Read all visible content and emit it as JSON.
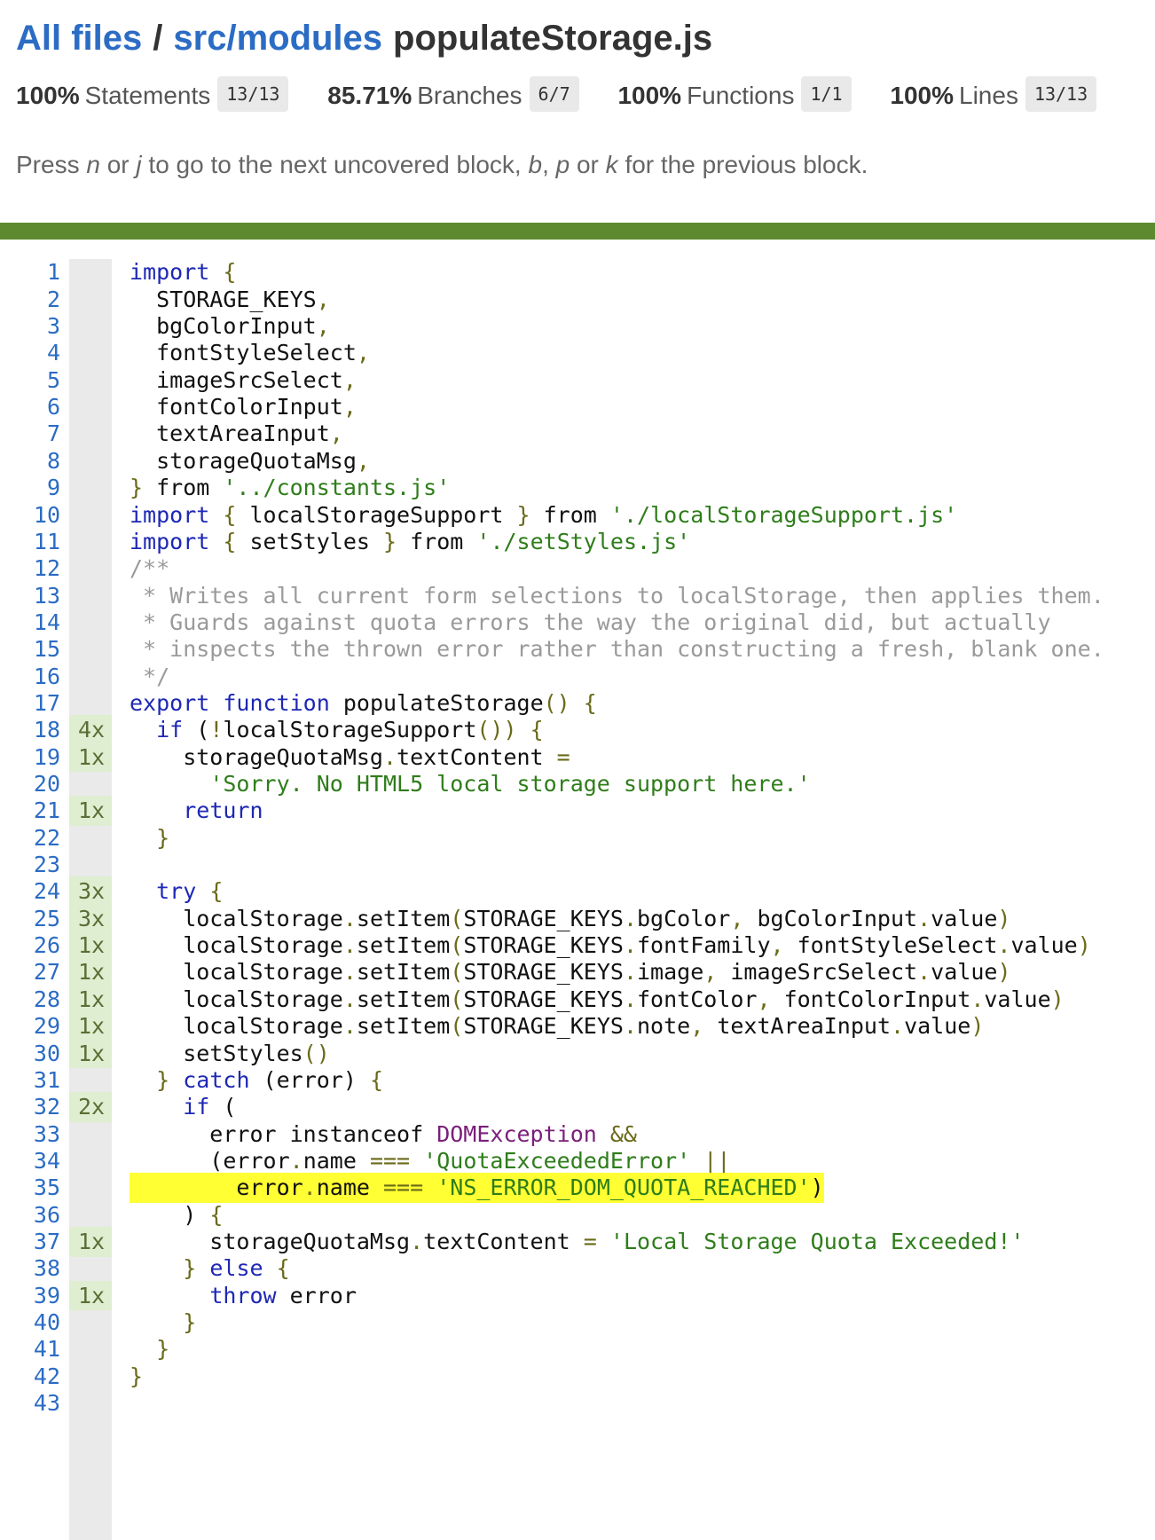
{
  "breadcrumb": {
    "all_files": "All files",
    "separator": "/",
    "dir": "src/modules",
    "file": "populateStorage.js"
  },
  "stats": [
    {
      "pct": "100%",
      "label": "Statements",
      "fraction": "13/13"
    },
    {
      "pct": "85.71%",
      "label": "Branches",
      "fraction": "6/7"
    },
    {
      "pct": "100%",
      "label": "Functions",
      "fraction": "1/1"
    },
    {
      "pct": "100%",
      "label": "Lines",
      "fraction": "13/13"
    }
  ],
  "hint": {
    "p1": "Press ",
    "k1": "n",
    "p2": " or ",
    "k2": "j",
    "p3": " to go to the next uncovered block, ",
    "k3": "b",
    "p4": ", ",
    "k4": "p",
    "p5": " or ",
    "k5": "k",
    "p6": " for the previous block."
  },
  "colors": {
    "link": "#2b6cc4",
    "status_bar": "#5d8a2f",
    "covered": "#dfeed1",
    "uncovered_branch": "#ffff33"
  },
  "lines": [
    {
      "n": "1",
      "cov": "",
      "tokens": [
        [
          "kw",
          "import"
        ],
        [
          "t",
          " "
        ],
        [
          "pun",
          "{"
        ]
      ]
    },
    {
      "n": "2",
      "cov": "",
      "tokens": [
        [
          "t",
          "  STORAGE_KEYS"
        ],
        [
          "pun",
          ","
        ]
      ]
    },
    {
      "n": "3",
      "cov": "",
      "tokens": [
        [
          "t",
          "  bgColorInput"
        ],
        [
          "pun",
          ","
        ]
      ]
    },
    {
      "n": "4",
      "cov": "",
      "tokens": [
        [
          "t",
          "  fontStyleSelect"
        ],
        [
          "pun",
          ","
        ]
      ]
    },
    {
      "n": "5",
      "cov": "",
      "tokens": [
        [
          "t",
          "  imageSrcSelect"
        ],
        [
          "pun",
          ","
        ]
      ]
    },
    {
      "n": "6",
      "cov": "",
      "tokens": [
        [
          "t",
          "  fontColorInput"
        ],
        [
          "pun",
          ","
        ]
      ]
    },
    {
      "n": "7",
      "cov": "",
      "tokens": [
        [
          "t",
          "  textAreaInput"
        ],
        [
          "pun",
          ","
        ]
      ]
    },
    {
      "n": "8",
      "cov": "",
      "tokens": [
        [
          "t",
          "  storageQuotaMsg"
        ],
        [
          "pun",
          ","
        ]
      ]
    },
    {
      "n": "9",
      "cov": "",
      "tokens": [
        [
          "pun",
          "}"
        ],
        [
          "t",
          " from "
        ],
        [
          "str",
          "'../constants.js'"
        ]
      ]
    },
    {
      "n": "10",
      "cov": "",
      "tokens": [
        [
          "kw",
          "import"
        ],
        [
          "t",
          " "
        ],
        [
          "pun",
          "{"
        ],
        [
          "t",
          " localStorageSupport "
        ],
        [
          "pun",
          "}"
        ],
        [
          "t",
          " from "
        ],
        [
          "str",
          "'./localStorageSupport.js'"
        ]
      ]
    },
    {
      "n": "11",
      "cov": "",
      "tokens": [
        [
          "kw",
          "import"
        ],
        [
          "t",
          " "
        ],
        [
          "pun",
          "{"
        ],
        [
          "t",
          " setStyles "
        ],
        [
          "pun",
          "}"
        ],
        [
          "t",
          " from "
        ],
        [
          "str",
          "'./setStyles.js'"
        ]
      ]
    },
    {
      "n": "12",
      "cov": "",
      "tokens": [
        [
          "cm",
          "/**"
        ]
      ]
    },
    {
      "n": "13",
      "cov": "",
      "tokens": [
        [
          "cm",
          " * Writes all current form selections to localStorage, then applies them."
        ]
      ]
    },
    {
      "n": "14",
      "cov": "",
      "tokens": [
        [
          "cm",
          " * Guards against quota errors the way the original did, but actually"
        ]
      ]
    },
    {
      "n": "15",
      "cov": "",
      "tokens": [
        [
          "cm",
          " * inspects the thrown error rather than constructing a fresh, blank one."
        ]
      ]
    },
    {
      "n": "16",
      "cov": "",
      "tokens": [
        [
          "cm",
          " */"
        ]
      ]
    },
    {
      "n": "17",
      "cov": "",
      "tokens": [
        [
          "kw",
          "export"
        ],
        [
          "t",
          " "
        ],
        [
          "kw",
          "function"
        ],
        [
          "t",
          " populateStorage"
        ],
        [
          "pun",
          "()"
        ],
        [
          "t",
          " "
        ],
        [
          "pun",
          "{"
        ]
      ]
    },
    {
      "n": "18",
      "cov": "4x",
      "tokens": [
        [
          "t",
          "  "
        ],
        [
          "kw",
          "if"
        ],
        [
          "t",
          " ("
        ],
        [
          "pun",
          "!"
        ],
        [
          "t",
          "localStorageSupport"
        ],
        [
          "pun",
          "())"
        ],
        [
          "t",
          " "
        ],
        [
          "pun",
          "{"
        ]
      ]
    },
    {
      "n": "19",
      "cov": "1x",
      "tokens": [
        [
          "t",
          "    storageQuotaMsg"
        ],
        [
          "pun",
          "."
        ],
        [
          "t",
          "textContent "
        ],
        [
          "pun",
          "="
        ]
      ]
    },
    {
      "n": "20",
      "cov": "",
      "tokens": [
        [
          "t",
          "      "
        ],
        [
          "str",
          "'Sorry. No HTML5 local storage support here.'"
        ]
      ]
    },
    {
      "n": "21",
      "cov": "1x",
      "tokens": [
        [
          "t",
          "    "
        ],
        [
          "kw",
          "return"
        ]
      ]
    },
    {
      "n": "22",
      "cov": "",
      "tokens": [
        [
          "t",
          "  "
        ],
        [
          "pun",
          "}"
        ]
      ]
    },
    {
      "n": "23",
      "cov": "",
      "tokens": [
        [
          "t",
          ""
        ]
      ]
    },
    {
      "n": "24",
      "cov": "3x",
      "tokens": [
        [
          "t",
          "  "
        ],
        [
          "kw",
          "try"
        ],
        [
          "t",
          " "
        ],
        [
          "pun",
          "{"
        ]
      ]
    },
    {
      "n": "25",
      "cov": "3x",
      "tokens": [
        [
          "t",
          "    localStorage"
        ],
        [
          "pun",
          "."
        ],
        [
          "t",
          "setItem"
        ],
        [
          "pun",
          "("
        ],
        [
          "t",
          "STORAGE_KEYS"
        ],
        [
          "pun",
          "."
        ],
        [
          "t",
          "bgColor"
        ],
        [
          "pun",
          ","
        ],
        [
          "t",
          " bgColorInput"
        ],
        [
          "pun",
          "."
        ],
        [
          "t",
          "value"
        ],
        [
          "pun",
          ")"
        ]
      ]
    },
    {
      "n": "26",
      "cov": "1x",
      "tokens": [
        [
          "t",
          "    localStorage"
        ],
        [
          "pun",
          "."
        ],
        [
          "t",
          "setItem"
        ],
        [
          "pun",
          "("
        ],
        [
          "t",
          "STORAGE_KEYS"
        ],
        [
          "pun",
          "."
        ],
        [
          "t",
          "fontFamily"
        ],
        [
          "pun",
          ","
        ],
        [
          "t",
          " fontStyleSelect"
        ],
        [
          "pun",
          "."
        ],
        [
          "t",
          "value"
        ],
        [
          "pun",
          ")"
        ]
      ]
    },
    {
      "n": "27",
      "cov": "1x",
      "tokens": [
        [
          "t",
          "    localStorage"
        ],
        [
          "pun",
          "."
        ],
        [
          "t",
          "setItem"
        ],
        [
          "pun",
          "("
        ],
        [
          "t",
          "STORAGE_KEYS"
        ],
        [
          "pun",
          "."
        ],
        [
          "t",
          "image"
        ],
        [
          "pun",
          ","
        ],
        [
          "t",
          " imageSrcSelect"
        ],
        [
          "pun",
          "."
        ],
        [
          "t",
          "value"
        ],
        [
          "pun",
          ")"
        ]
      ]
    },
    {
      "n": "28",
      "cov": "1x",
      "tokens": [
        [
          "t",
          "    localStorage"
        ],
        [
          "pun",
          "."
        ],
        [
          "t",
          "setItem"
        ],
        [
          "pun",
          "("
        ],
        [
          "t",
          "STORAGE_KEYS"
        ],
        [
          "pun",
          "."
        ],
        [
          "t",
          "fontColor"
        ],
        [
          "pun",
          ","
        ],
        [
          "t",
          " fontColorInput"
        ],
        [
          "pun",
          "."
        ],
        [
          "t",
          "value"
        ],
        [
          "pun",
          ")"
        ]
      ]
    },
    {
      "n": "29",
      "cov": "1x",
      "tokens": [
        [
          "t",
          "    localStorage"
        ],
        [
          "pun",
          "."
        ],
        [
          "t",
          "setItem"
        ],
        [
          "pun",
          "("
        ],
        [
          "t",
          "STORAGE_KEYS"
        ],
        [
          "pun",
          "."
        ],
        [
          "t",
          "note"
        ],
        [
          "pun",
          ","
        ],
        [
          "t",
          " textAreaInput"
        ],
        [
          "pun",
          "."
        ],
        [
          "t",
          "value"
        ],
        [
          "pun",
          ")"
        ]
      ]
    },
    {
      "n": "30",
      "cov": "1x",
      "tokens": [
        [
          "t",
          "    setStyles"
        ],
        [
          "pun",
          "()"
        ]
      ]
    },
    {
      "n": "31",
      "cov": "",
      "tokens": [
        [
          "t",
          "  "
        ],
        [
          "pun",
          "}"
        ],
        [
          "t",
          " "
        ],
        [
          "kw",
          "catch"
        ],
        [
          "t",
          " (error) "
        ],
        [
          "pun",
          "{"
        ]
      ]
    },
    {
      "n": "32",
      "cov": "2x",
      "tokens": [
        [
          "t",
          "    "
        ],
        [
          "kw",
          "if"
        ],
        [
          "t",
          " ("
        ]
      ]
    },
    {
      "n": "33",
      "cov": "",
      "tokens": [
        [
          "t",
          "      error instanceof "
        ],
        [
          "cls",
          "DOMException"
        ],
        [
          "t",
          " "
        ],
        [
          "pun",
          "&&"
        ]
      ]
    },
    {
      "n": "34",
      "cov": "",
      "tokens": [
        [
          "t",
          "      (error"
        ],
        [
          "pun",
          "."
        ],
        [
          "t",
          "name "
        ],
        [
          "pun",
          "==="
        ],
        [
          "t",
          " "
        ],
        [
          "str",
          "'QuotaExceededError'"
        ],
        [
          "t",
          " "
        ],
        [
          "pun",
          "||"
        ]
      ]
    },
    {
      "n": "35",
      "cov": "",
      "highlight": true,
      "tokens": [
        [
          "t",
          "        error"
        ],
        [
          "pun",
          "."
        ],
        [
          "t",
          "name "
        ],
        [
          "pun",
          "==="
        ],
        [
          "t",
          " "
        ],
        [
          "str",
          "'NS_ERROR_DOM_QUOTA_REACHED'"
        ],
        [
          "t",
          ")"
        ]
      ]
    },
    {
      "n": "36",
      "cov": "",
      "tokens": [
        [
          "t",
          "    ) "
        ],
        [
          "pun",
          "{"
        ]
      ]
    },
    {
      "n": "37",
      "cov": "1x",
      "tokens": [
        [
          "t",
          "      storageQuotaMsg"
        ],
        [
          "pun",
          "."
        ],
        [
          "t",
          "textContent "
        ],
        [
          "pun",
          "="
        ],
        [
          "t",
          " "
        ],
        [
          "str",
          "'Local Storage Quota Exceeded!'"
        ]
      ]
    },
    {
      "n": "38",
      "cov": "",
      "tokens": [
        [
          "t",
          "    "
        ],
        [
          "pun",
          "}"
        ],
        [
          "t",
          " "
        ],
        [
          "kw",
          "else"
        ],
        [
          "t",
          " "
        ],
        [
          "pun",
          "{"
        ]
      ]
    },
    {
      "n": "39",
      "cov": "1x",
      "tokens": [
        [
          "t",
          "      "
        ],
        [
          "kw",
          "throw"
        ],
        [
          "t",
          " error"
        ]
      ]
    },
    {
      "n": "40",
      "cov": "",
      "tokens": [
        [
          "t",
          "    "
        ],
        [
          "pun",
          "}"
        ]
      ]
    },
    {
      "n": "41",
      "cov": "",
      "tokens": [
        [
          "t",
          "  "
        ],
        [
          "pun",
          "}"
        ]
      ]
    },
    {
      "n": "42",
      "cov": "",
      "tokens": [
        [
          "pun",
          "}"
        ]
      ]
    },
    {
      "n": "43",
      "cov": "",
      "tokens": [
        [
          "t",
          ""
        ]
      ]
    }
  ]
}
